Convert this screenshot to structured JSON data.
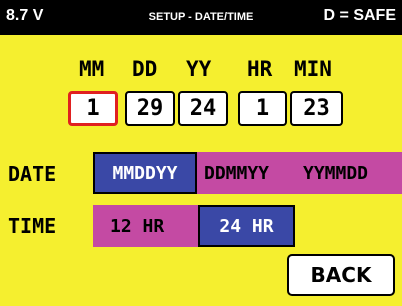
{
  "status_bar": {
    "voltage": "8.7 V",
    "title": "SETUP - DATE/TIME",
    "mode": "D = SAFE"
  },
  "columns": {
    "month": {
      "label": "MM",
      "value": "1"
    },
    "day": {
      "label": "DD",
      "value": "29"
    },
    "year": {
      "label": "YY",
      "value": "24"
    },
    "hour": {
      "label": "HR",
      "value": "1"
    },
    "minute": {
      "label": "MIN",
      "value": "23"
    }
  },
  "date_format": {
    "label": "DATE",
    "options": [
      "MMDDYY",
      "DDMMYY",
      "YYMMDD"
    ],
    "selected": "MMDDYY"
  },
  "time_format": {
    "label": "TIME",
    "options": [
      "12 HR",
      "24 HR"
    ],
    "selected": "24 HR"
  },
  "back_label": "BACK",
  "colors": {
    "background": "#f5ef2f",
    "band": "#c44aa3",
    "selected": "#3a48a6",
    "focus": "#e02020"
  }
}
